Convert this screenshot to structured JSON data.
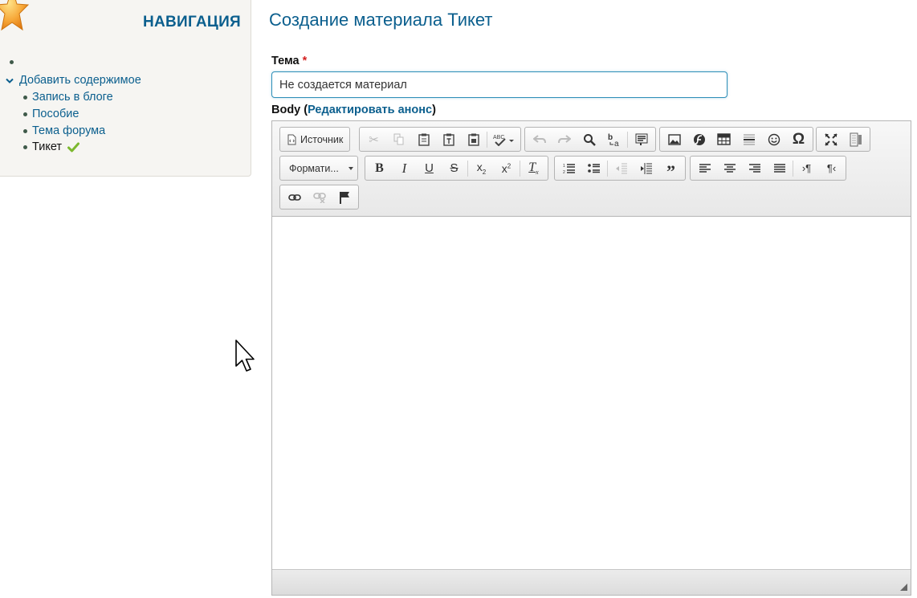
{
  "sidebar": {
    "title": "НАВИГАЦИЯ",
    "items": [
      {
        "label": "Добавить содержимое",
        "icon": "chevron-down-icon"
      },
      {
        "label": "Запись в блоге"
      },
      {
        "label": "Пособие"
      },
      {
        "label": "Тема форума"
      },
      {
        "label": "Тикет",
        "active": true,
        "badge_icon": "checkmark-icon"
      }
    ]
  },
  "page": {
    "title": "Создание материала Тикет"
  },
  "form": {
    "subject_label": "Тема",
    "required_mark": "*",
    "subject_value": "Не создается материал",
    "body_label": "Body",
    "body_open": " (",
    "edit_summary_link": "Редактировать анонс",
    "body_close": ")"
  },
  "editor": {
    "source_label": "Источник",
    "format_label": "Формати...",
    "toolbar_icons": [
      "source-icon",
      "cut-icon",
      "copy-icon",
      "paste-icon",
      "paste-text-icon",
      "paste-word-icon",
      "spellcheck-icon",
      "undo-icon",
      "redo-icon",
      "find-icon",
      "replace-icon",
      "select-all-icon",
      "image-icon",
      "flash-icon",
      "table-icon",
      "horizontal-rule-icon",
      "smiley-icon",
      "special-char-icon",
      "maximize-icon",
      "show-blocks-icon",
      "bold-icon",
      "italic-icon",
      "underline-icon",
      "strike-icon",
      "subscript-icon",
      "superscript-icon",
      "remove-format-icon",
      "numbered-list-icon",
      "bulleted-list-icon",
      "outdent-icon",
      "indent-icon",
      "blockquote-icon",
      "align-left-icon",
      "align-center-icon",
      "align-right-icon",
      "justify-icon",
      "ltr-icon",
      "rtl-icon",
      "link-icon",
      "unlink-icon",
      "anchor-icon"
    ]
  },
  "colors": {
    "accent": "#0b5f8e",
    "required": "#d42020",
    "input_border": "#2f8fb8",
    "check": "#7cb82f"
  }
}
